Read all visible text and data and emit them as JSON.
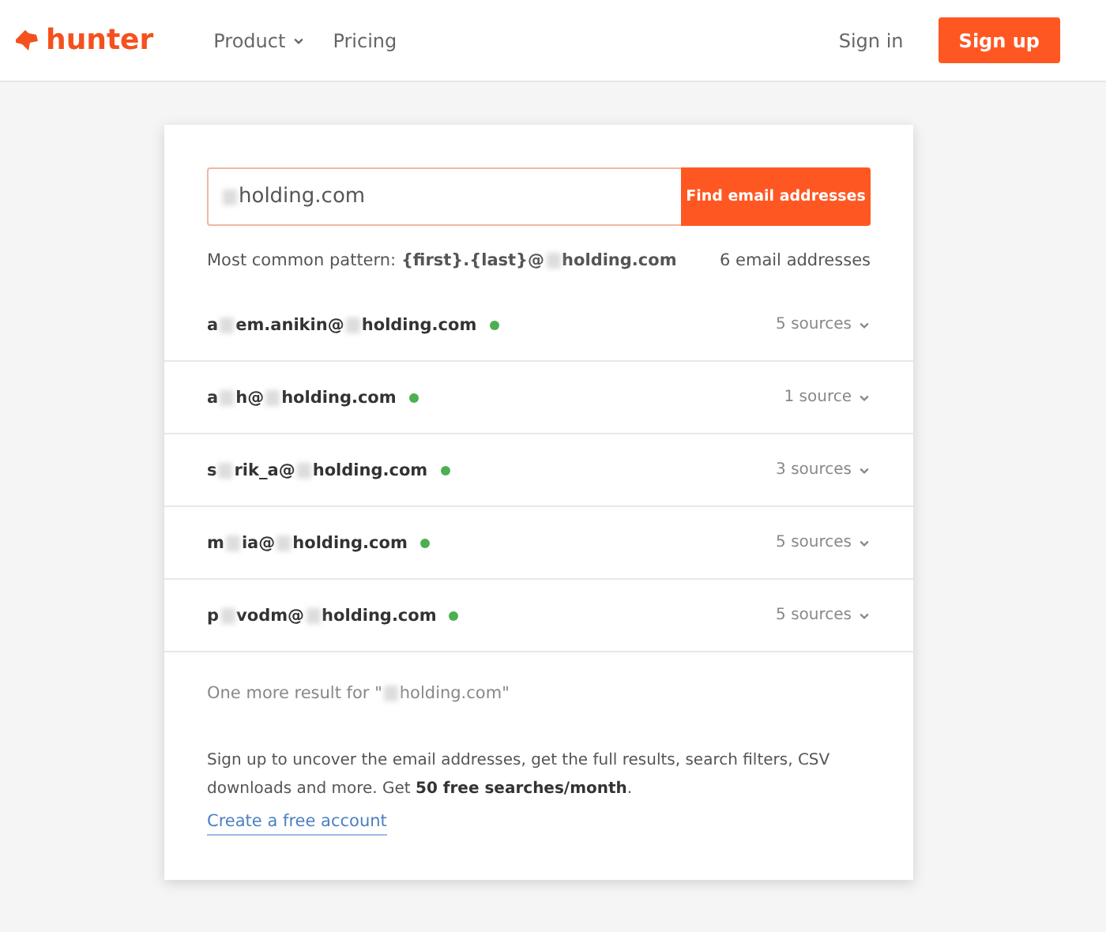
{
  "header": {
    "logo": "hunter",
    "nav": [
      {
        "label": "Product",
        "kind": "dropdown"
      },
      {
        "label": "Pricing",
        "kind": "link"
      }
    ],
    "sign_in": "Sign in",
    "sign_up": "Sign up"
  },
  "search": {
    "value_parts": [
      "holding.com"
    ],
    "leading_blur": true,
    "button": "Find email addresses"
  },
  "summary": {
    "pattern_label": "Most common pattern:",
    "pattern_parts": [
      "{first}.{last}@",
      "holding.com"
    ],
    "count": "6 email addresses"
  },
  "emails": [
    {
      "parts": [
        "a",
        "em.anikin@",
        "holding.com"
      ],
      "verified": true,
      "sources": "5 sources"
    },
    {
      "parts": [
        "a",
        "h@",
        "holding.com"
      ],
      "verified": true,
      "sources": "1 source"
    },
    {
      "parts": [
        "s",
        "rik_a@",
        "holding.com"
      ],
      "verified": true,
      "sources": "3 sources"
    },
    {
      "parts": [
        "m",
        "ia@",
        "holding.com"
      ],
      "verified": true,
      "sources": "5 sources"
    },
    {
      "parts": [
        "p",
        "vodm@",
        "holding.com"
      ],
      "verified": true,
      "sources": "5 sources"
    }
  ],
  "more_result": {
    "prefix": "One more result for \"",
    "parts": [
      "holding.com\""
    ],
    "leading_blur": true
  },
  "signup_text": "Sign up to uncover the email addresses, get the full results, search filters, CSV downloads and more. Get **50 free searches/month**.",
  "create_account": "Create a free account"
}
